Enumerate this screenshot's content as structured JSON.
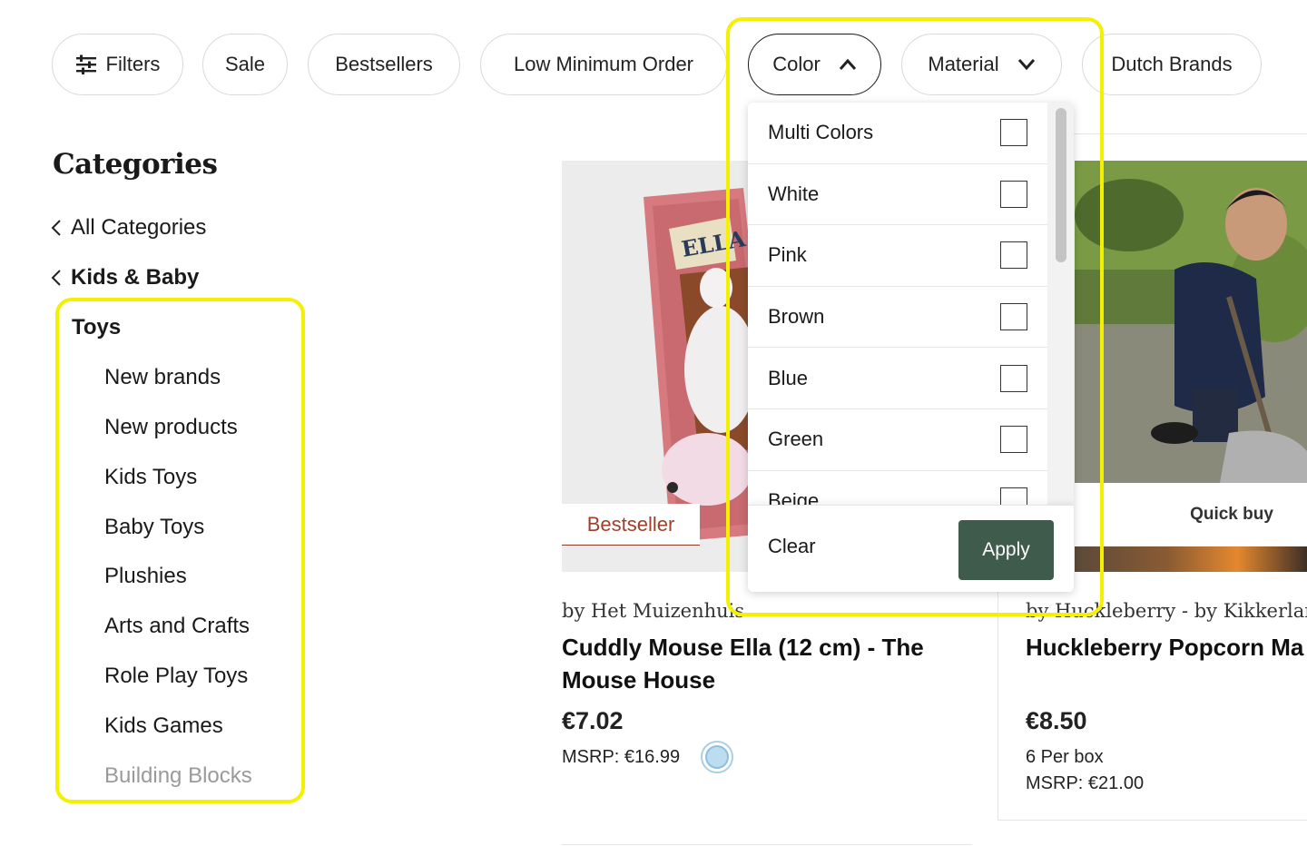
{
  "filters": {
    "filters_label": "Filters",
    "sale": "Sale",
    "bestsellers": "Bestsellers",
    "low_min": "Low Minimum Order",
    "color": "Color",
    "material": "Material",
    "dutch": "Dutch Brands"
  },
  "sidebar": {
    "title": "Categories",
    "all": "All Categories",
    "parent": "Kids & Baby",
    "current": "Toys",
    "items": [
      {
        "label": "New brands"
      },
      {
        "label": "New products"
      },
      {
        "label": "Kids Toys"
      },
      {
        "label": "Baby Toys"
      },
      {
        "label": "Plushies"
      },
      {
        "label": "Arts and Crafts"
      },
      {
        "label": "Role Play Toys"
      },
      {
        "label": "Kids Games"
      },
      {
        "label": "Building Blocks"
      }
    ]
  },
  "color_dropdown": {
    "options": [
      {
        "label": "Multi Colors"
      },
      {
        "label": "White"
      },
      {
        "label": "Pink"
      },
      {
        "label": "Brown"
      },
      {
        "label": "Blue"
      },
      {
        "label": "Green"
      },
      {
        "label": "Beige"
      }
    ],
    "clear": "Clear",
    "apply": "Apply"
  },
  "products": [
    {
      "badge": "Bestseller",
      "brand": "by Het Muizenhuis",
      "name_line1": "Cuddly Mouse Ella (12 cm) - The",
      "name_line2": "Mouse House",
      "price": "€7.02",
      "msrp": "MSRP: €16.99",
      "box_text": "ELLA"
    },
    {
      "quick_buy": "Quick buy",
      "brand": "by Huckleberry - by Kikkerland",
      "name": "Huckleberry Popcorn Ma",
      "price": "€8.50",
      "per_box": "6 Per box",
      "msrp": "MSRP: €21.00"
    }
  ],
  "colors": {
    "highlight": "#f5ef00",
    "apply_bg": "#3f5b4b",
    "badge_text": "#a0402c"
  }
}
